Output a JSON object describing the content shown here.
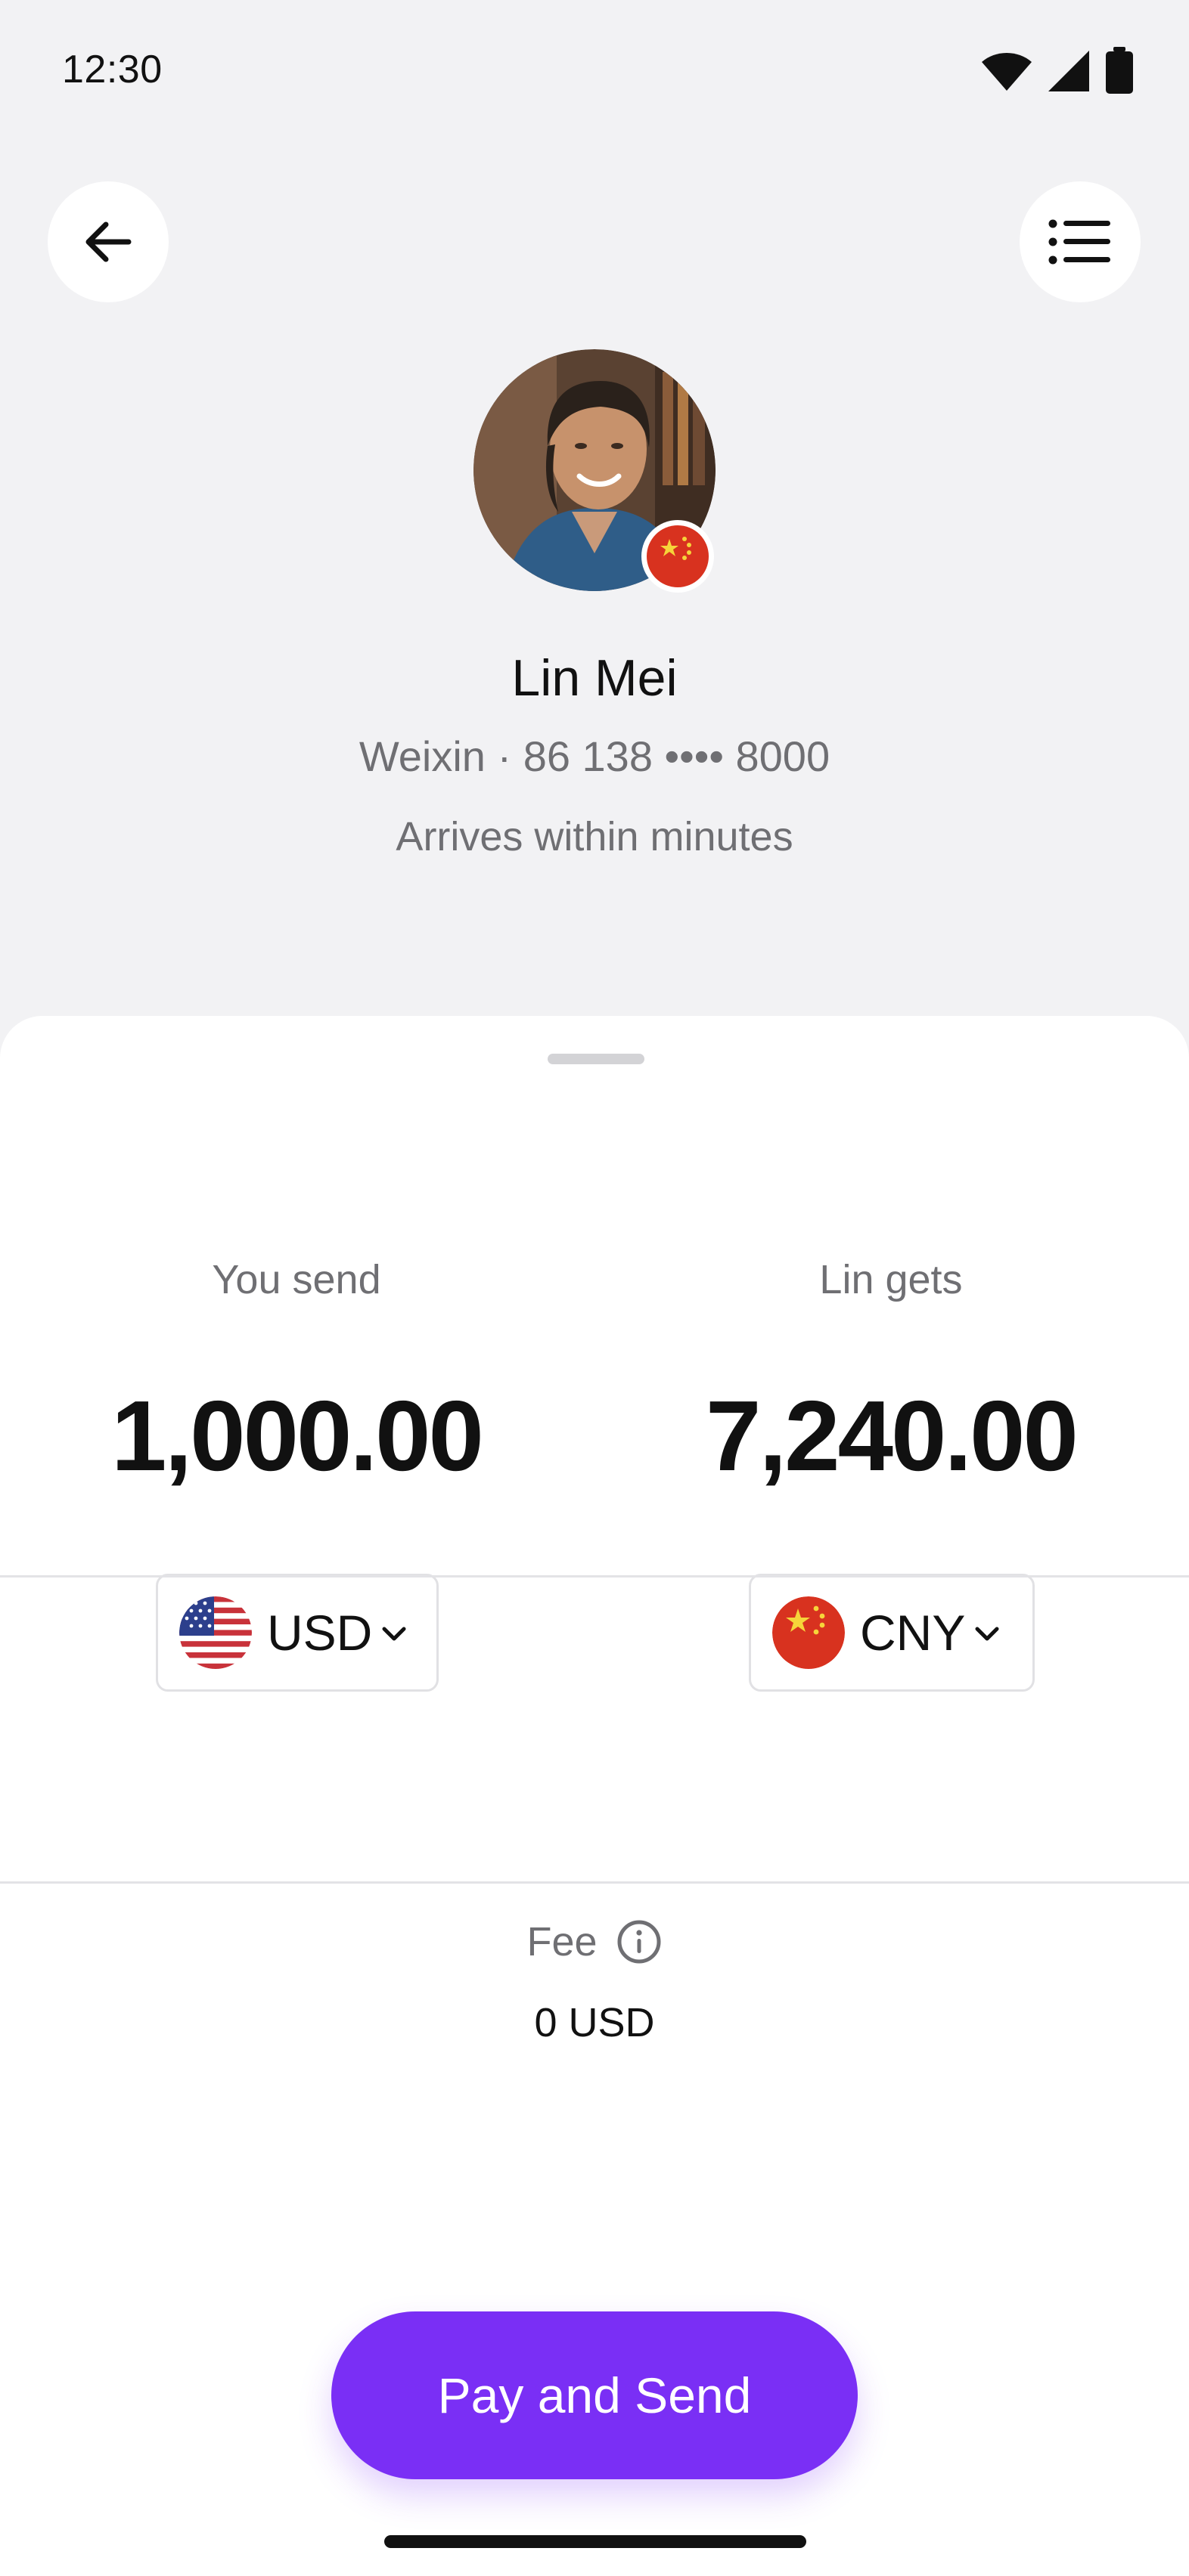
{
  "status_bar": {
    "time": "12:30",
    "icons": [
      "wifi-icon",
      "signal-icon",
      "battery-icon"
    ]
  },
  "header": {
    "back_icon": "arrow-left-icon",
    "menu_icon": "list-icon"
  },
  "recipient": {
    "name": "Lin Mei",
    "handle": "Weixin · 86 138 •••• 8000",
    "eta": "Arrives within minutes",
    "flag": "china-flag-icon"
  },
  "send": {
    "label": "You send",
    "amount": "1,000.00",
    "currency": "USD",
    "flag": "us-flag-icon"
  },
  "gets": {
    "label": "Lin gets",
    "amount": "7,240.00",
    "currency": "CNY",
    "flag": "china-flag-icon"
  },
  "fee": {
    "label": "Fee",
    "value": "0 USD",
    "info_icon": "info-icon"
  },
  "action": {
    "pay_label": "Pay and Send"
  },
  "colors": {
    "accent": "#7a2ff5",
    "background": "#f2f2f4",
    "sheet": "#ffffff",
    "muted_text": "#6f6f73"
  }
}
